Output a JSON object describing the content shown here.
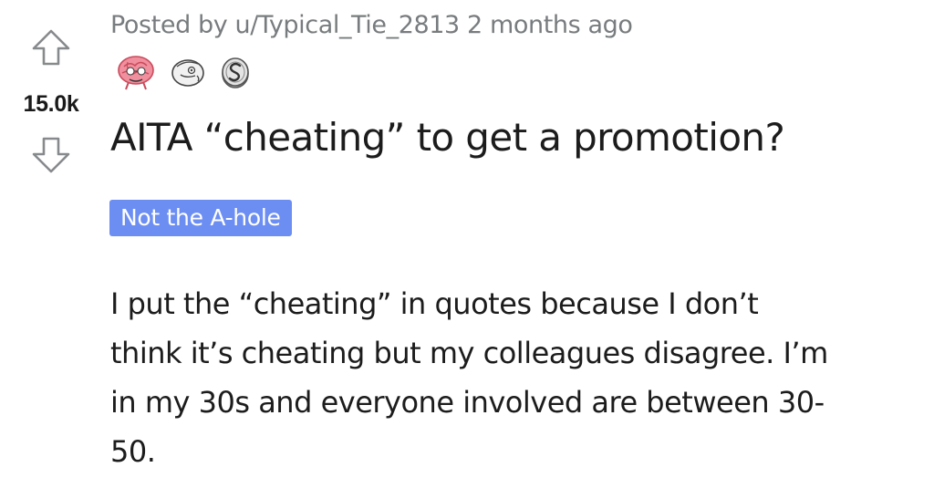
{
  "post": {
    "score": "15.0k",
    "posted_by_prefix": "Posted by",
    "author": "u/Typical_Tie_2813",
    "time_ago": "2 months ago",
    "awards": [
      {
        "icon": "pink-brain-award-icon"
      },
      {
        "icon": "doodle-face-award-icon"
      },
      {
        "icon": "silver-coin-award-icon"
      }
    ],
    "title": "AITA “cheating” to get a promotion?",
    "flair": {
      "label": "Not the A-hole",
      "color": "#6c8ef3"
    },
    "body_lines": [
      "I put the “cheating” in quotes because I don’t",
      "think it’s cheating but my colleagues disagree. I’m",
      "in my 30s and everyone involved are between 30-",
      "50."
    ]
  },
  "icons": {
    "upvote": "upvote-arrow-icon",
    "downvote": "downvote-arrow-icon"
  }
}
